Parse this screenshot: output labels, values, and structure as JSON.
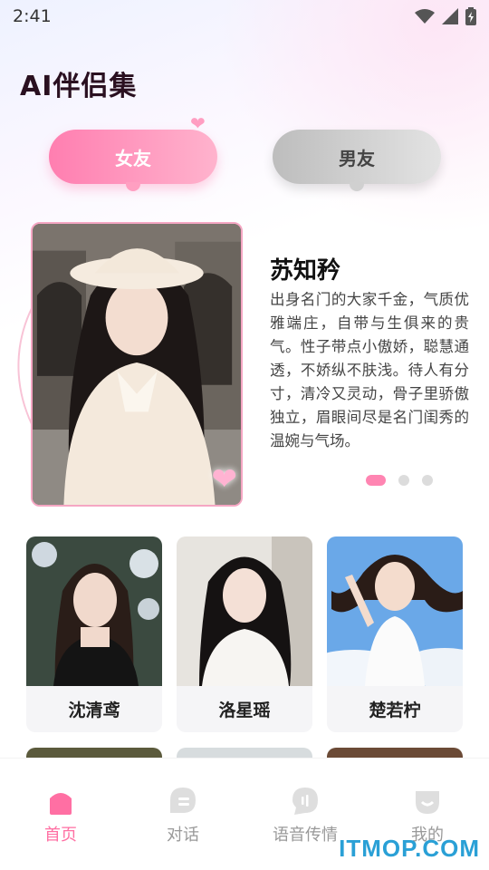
{
  "status_bar": {
    "time": "2:41"
  },
  "page_title": "AI伴侣集",
  "tabs": [
    {
      "label": "女友",
      "active": true
    },
    {
      "label": "男友",
      "active": false
    }
  ],
  "featured": {
    "name": "苏知矜",
    "description": "出身名门的大家千金，气质优雅端庄，自带与生俱来的贵气。性子带点小傲娇，聪慧通透，不娇纵不肤浅。待人有分寸，清冷又灵动，骨子里骄傲独立，眉眼间尽是名门闺秀的温婉与气场。",
    "carousel_pages": 3,
    "carousel_active": 1
  },
  "characters": [
    {
      "name": "沈清鸢"
    },
    {
      "name": "洛星瑶"
    },
    {
      "name": "楚若柠"
    }
  ],
  "bottom_nav": [
    {
      "label": "首页",
      "icon": "home-icon",
      "active": true
    },
    {
      "label": "对话",
      "icon": "chat-bubble-icon",
      "active": false
    },
    {
      "label": "语音传情",
      "icon": "voice-message-icon",
      "active": false
    },
    {
      "label": "我的",
      "icon": "profile-icon",
      "active": false
    }
  ],
  "watermark": "ITMOP.COM",
  "colors": {
    "accent": "#ff7eb0",
    "inactive": "#999999"
  }
}
